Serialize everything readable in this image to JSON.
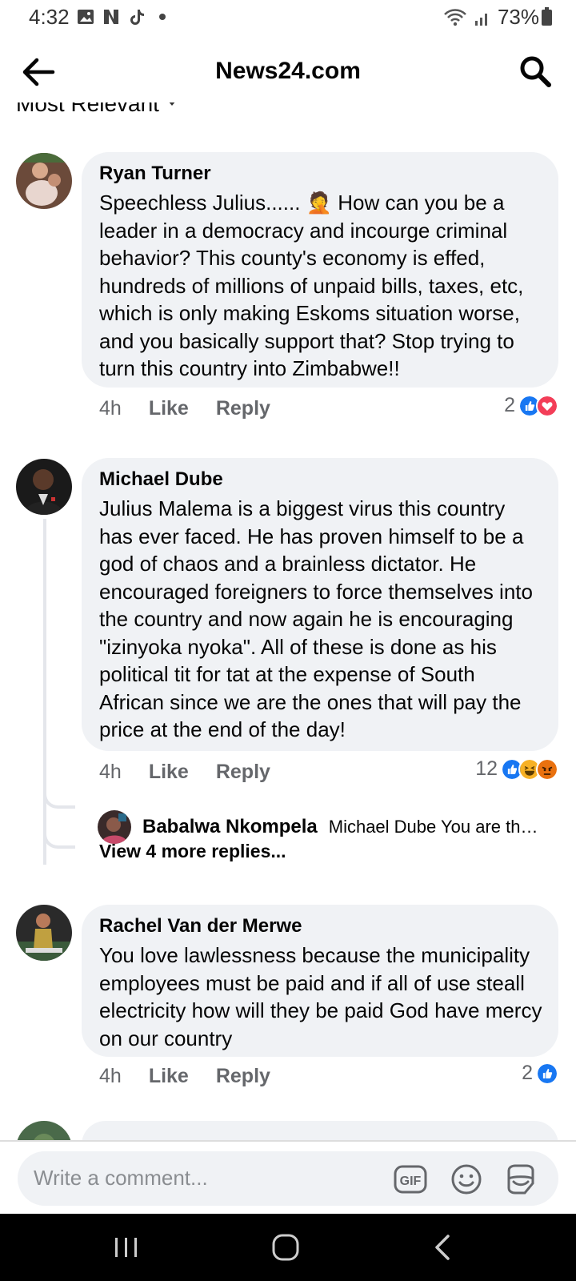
{
  "status_bar": {
    "time": "4:32",
    "battery": "73%"
  },
  "header": {
    "title": "News24.com"
  },
  "sort": {
    "label": "Most Relevant"
  },
  "comments": [
    {
      "author": "Ryan Turner",
      "text": "Speechless Julius...... 🤦 How can you be a leader in a democracy and incourge criminal behavior? This county's economy is effed, hundreds of millions of unpaid bills, taxes, etc, which is only making Eskoms situation worse, and you basically support that? Stop trying to turn this country into Zimbabwe!!",
      "time": "4h",
      "like": "Like",
      "reply": "Reply",
      "reaction_count": "2"
    },
    {
      "author": "Michael Dube",
      "text": "Julius Malema is a biggest virus this country has ever faced. He has proven himself to be a god of chaos  and a brainless dictator. He encouraged foreigners to force themselves into the country and now again he is encouraging \"izinyoka nyoka\". All of these is done as his political tit for tat at the expense of South African since we are the ones that will pay the price at the end of the day!",
      "time": "4h",
      "like": "Like",
      "reply": "Reply",
      "reaction_count": "12",
      "reply_preview": {
        "author": "Babalwa Nkompela",
        "snippet": "Michael Dube You are the ..."
      },
      "view_more": "View 4 more replies..."
    },
    {
      "author": "Rachel Van der Merwe",
      "text": "You love lawlessness because the municipality employees must be paid and if all of use steall electricity how will they be paid God have mercy on our country",
      "time": "4h",
      "like": "Like",
      "reply": "Reply",
      "reaction_count": "2"
    }
  ],
  "composer": {
    "placeholder": "Write a comment...",
    "gif_label": "GIF"
  },
  "colors": {
    "like_blue": "#1877f2",
    "love_red": "#f33e58",
    "haha_yellow": "#f7b125",
    "angry_orange": "#e9710f",
    "bubble_bg": "#f0f2f5"
  }
}
